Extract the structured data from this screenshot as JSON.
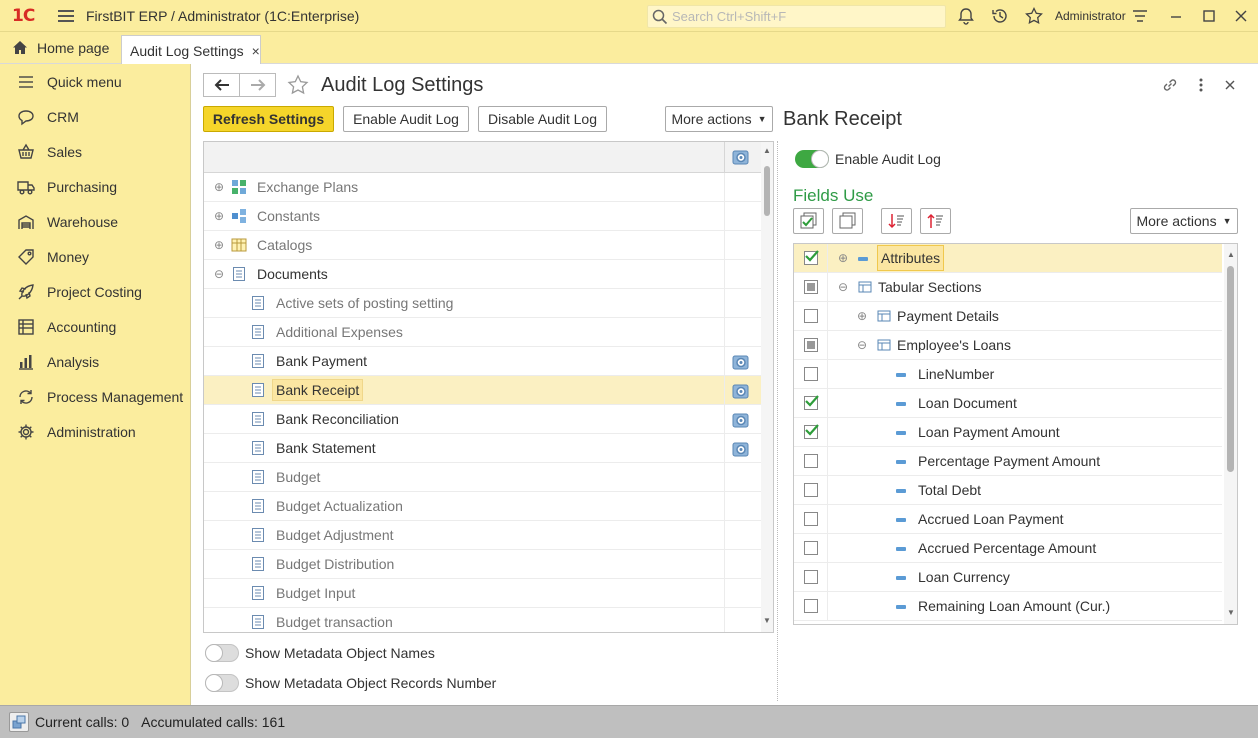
{
  "titlebar": {
    "logo": "1С",
    "title": "FirstBIT ERP / Administrator  (1C:Enterprise)",
    "search_placeholder": "Search Ctrl+Shift+F",
    "user": "Administrator"
  },
  "tabs": {
    "home": "Home page",
    "active": "Audit Log Settings",
    "close": "×"
  },
  "sidebar": {
    "items": [
      {
        "label": "Quick menu",
        "icon": "hamburger-icon"
      },
      {
        "label": "CRM",
        "icon": "chat-icon"
      },
      {
        "label": "Sales",
        "icon": "basket-icon"
      },
      {
        "label": "Purchasing",
        "icon": "truck-icon"
      },
      {
        "label": "Warehouse",
        "icon": "warehouse-icon"
      },
      {
        "label": "Money",
        "icon": "tag-icon"
      },
      {
        "label": "Project Costing",
        "icon": "rocket-icon"
      },
      {
        "label": "Accounting",
        "icon": "ledger-icon"
      },
      {
        "label": "Analysis",
        "icon": "bar-chart-icon"
      },
      {
        "label": "Process Management",
        "icon": "cycle-icon"
      },
      {
        "label": "Administration",
        "icon": "gear-icon"
      }
    ]
  },
  "page": {
    "title": "Audit Log Settings",
    "buttons": {
      "refresh": "Refresh Settings",
      "enable": "Enable Audit Log",
      "disable": "Disable Audit Log",
      "more": "More actions"
    }
  },
  "tree": {
    "rows": [
      {
        "label": "Exchange Plans",
        "expander": "⊕",
        "level": 0,
        "gray": true
      },
      {
        "label": "Constants",
        "expander": "⊕",
        "level": 0,
        "gray": true
      },
      {
        "label": "Catalogs",
        "expander": "⊕",
        "level": 0,
        "gray": true
      },
      {
        "label": "Documents",
        "expander": "⊖",
        "level": 0,
        "gray": false
      },
      {
        "label": "Active sets of posting setting",
        "level": 1,
        "gray": true
      },
      {
        "label": "Additional Expenses",
        "level": 1,
        "gray": true
      },
      {
        "label": "Bank Payment",
        "level": 1,
        "gray": false,
        "gear": true
      },
      {
        "label": "Bank Receipt",
        "level": 1,
        "gray": false,
        "gear": true,
        "selected": true
      },
      {
        "label": "Bank Reconciliation",
        "level": 1,
        "gray": false,
        "gear": true
      },
      {
        "label": "Bank Statement",
        "level": 1,
        "gray": false,
        "gear": true
      },
      {
        "label": "Budget",
        "level": 1,
        "gray": true
      },
      {
        "label": "Budget Actualization",
        "level": 1,
        "gray": true
      },
      {
        "label": "Budget Adjustment",
        "level": 1,
        "gray": true
      },
      {
        "label": "Budget Distribution",
        "level": 1,
        "gray": true
      },
      {
        "label": "Budget Input",
        "level": 1,
        "gray": true
      },
      {
        "label": "Budget transaction",
        "level": 1,
        "gray": true
      }
    ]
  },
  "toggles": {
    "show_names": "Show Metadata Object Names",
    "show_records": "Show Metadata Object Records Number"
  },
  "right": {
    "title": "Bank Receipt",
    "enable_label": "Enable Audit Log",
    "fields_title": "Fields Use",
    "more": "More actions",
    "rows": [
      {
        "label": "Attributes",
        "check": "checked",
        "level": 0,
        "expander": "⊕",
        "icon": "dash",
        "selected": true
      },
      {
        "label": "Tabular Sections",
        "check": "indeterminate",
        "level": 0,
        "expander": "⊖",
        "icon": "table"
      },
      {
        "label": "Payment Details",
        "check": "unchecked",
        "level": 1,
        "expander": "⊕",
        "icon": "table"
      },
      {
        "label": "Employee's Loans",
        "check": "indeterminate",
        "level": 1,
        "expander": "⊖",
        "icon": "table"
      },
      {
        "label": "LineNumber",
        "check": "unchecked",
        "level": 2,
        "icon": "dash"
      },
      {
        "label": "Loan Document",
        "check": "checked",
        "level": 2,
        "icon": "dash"
      },
      {
        "label": "Loan Payment Amount",
        "check": "checked",
        "level": 2,
        "icon": "dash"
      },
      {
        "label": "Percentage Payment Amount",
        "check": "unchecked",
        "level": 2,
        "icon": "dash"
      },
      {
        "label": "Total Debt",
        "check": "unchecked",
        "level": 2,
        "icon": "dash"
      },
      {
        "label": "Accrued Loan Payment",
        "check": "unchecked",
        "level": 2,
        "icon": "dash"
      },
      {
        "label": "Accrued Percentage Amount",
        "check": "unchecked",
        "level": 2,
        "icon": "dash"
      },
      {
        "label": "Loan Currency",
        "check": "unchecked",
        "level": 2,
        "icon": "dash"
      },
      {
        "label": "Remaining Loan Amount (Cur.)",
        "check": "unchecked",
        "level": 2,
        "icon": "dash"
      }
    ]
  },
  "status": {
    "current": "Current calls: 0",
    "accumulated": "Accumulated calls: 161"
  },
  "colors": {
    "accent_yellow": "#fbed9e",
    "primary_button": "#f5d52a",
    "green_title": "#2f9b46",
    "check_green": "#2e9d3a"
  }
}
